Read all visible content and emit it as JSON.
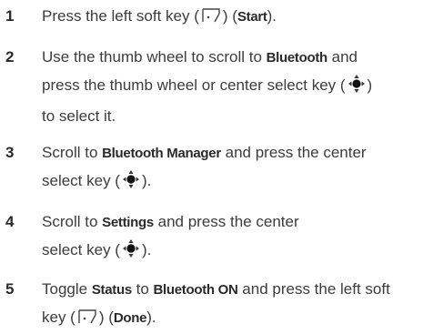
{
  "steps": [
    {
      "number": "1",
      "lines": [
        {
          "parts": [
            {
              "t": "text",
              "v": "Press the left soft key ("
            },
            {
              "t": "icon",
              "v": "soft-key-icon"
            },
            {
              "t": "text",
              "v": ") ("
            },
            {
              "t": "term",
              "v": "Start"
            },
            {
              "t": "text",
              "v": ")."
            }
          ]
        }
      ]
    },
    {
      "number": "2",
      "lines": [
        {
          "parts": [
            {
              "t": "text",
              "v": "Use the thumb wheel to scroll to "
            },
            {
              "t": "term",
              "v": "Bluetooth"
            },
            {
              "t": "text",
              "v": " and"
            }
          ]
        },
        {
          "parts": [
            {
              "t": "text",
              "v": "press the thumb wheel or center select key ("
            },
            {
              "t": "icon",
              "v": "center-select-key-icon"
            },
            {
              "t": "text",
              "v": ")"
            }
          ]
        },
        {
          "parts": [
            {
              "t": "text",
              "v": "to select it."
            }
          ]
        }
      ]
    },
    {
      "number": "3",
      "lines": [
        {
          "parts": [
            {
              "t": "text",
              "v": "Scroll to "
            },
            {
              "t": "term",
              "v": "Bluetooth Manager"
            },
            {
              "t": "text",
              "v": " and press the center"
            }
          ]
        },
        {
          "parts": [
            {
              "t": "text",
              "v": "select key ("
            },
            {
              "t": "icon",
              "v": "center-select-key-icon"
            },
            {
              "t": "text",
              "v": ")."
            }
          ]
        }
      ]
    },
    {
      "number": "4",
      "lines": [
        {
          "parts": [
            {
              "t": "text",
              "v": "Scroll to "
            },
            {
              "t": "term",
              "v": "Settings"
            },
            {
              "t": "text",
              "v": " and press the center"
            }
          ]
        },
        {
          "parts": [
            {
              "t": "text",
              "v": "select key ("
            },
            {
              "t": "icon",
              "v": "center-select-key-icon"
            },
            {
              "t": "text",
              "v": ")."
            }
          ]
        }
      ]
    },
    {
      "number": "5",
      "lines": [
        {
          "parts": [
            {
              "t": "text",
              "v": "Toggle "
            },
            {
              "t": "term",
              "v": "Status"
            },
            {
              "t": "text",
              "v": " to "
            },
            {
              "t": "term",
              "v": "Bluetooth ON"
            },
            {
              "t": "text",
              "v": " and press the left soft"
            }
          ]
        },
        {
          "parts": [
            {
              "t": "text",
              "v": "key ("
            },
            {
              "t": "icon",
              "v": "soft-key-icon"
            },
            {
              "t": "text",
              "v": ") ("
            },
            {
              "t": "term",
              "v": "Done"
            },
            {
              "t": "text",
              "v": ")."
            }
          ]
        }
      ]
    }
  ]
}
